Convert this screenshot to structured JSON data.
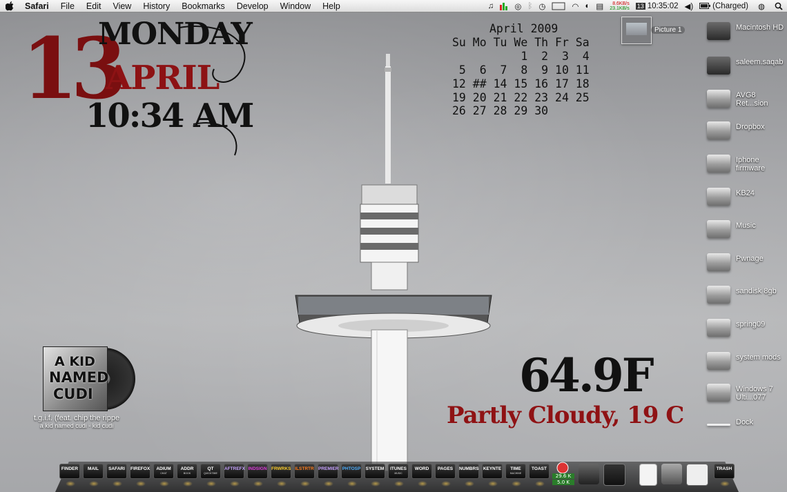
{
  "menubar": {
    "app": "Safari",
    "menus": [
      "File",
      "Edit",
      "View",
      "History",
      "Bookmarks",
      "Develop",
      "Window",
      "Help"
    ],
    "net_up": "8.6KB/s",
    "net_down": "23.1KB/s",
    "date_badge": "13",
    "clock": "10:35:02",
    "battery": "(Charged)"
  },
  "date_widget": {
    "day_number": "13",
    "weekday": "MONDAY",
    "month": "APRIL",
    "time": "10:34 AM"
  },
  "calendar": {
    "header": "April 2009",
    "weekdays": "Su Mo Tu We Th Fr Sa",
    "weeks": [
      "          1  2  3  4",
      " 5  6  7  8  9 10 11",
      "12 ## 14 15 16 17 18",
      "19 20 21 22 23 24 25",
      "26 27 28 29 30"
    ]
  },
  "picture_icon": {
    "label": "Picture 1"
  },
  "desktop_icons": [
    {
      "label": "Macintosh HD",
      "dark": true
    },
    {
      "label": "saleem.saqab",
      "dark": true
    },
    {
      "label": "AVG8 Ret...sion",
      "dark": false
    },
    {
      "label": "Dropbox",
      "dark": false
    },
    {
      "label": "Iphone firmware",
      "dark": false
    },
    {
      "label": "KB24",
      "dark": false
    },
    {
      "label": "Music",
      "dark": false
    },
    {
      "label": "Pwnage",
      "dark": false
    },
    {
      "label": "sandisk 8gb",
      "dark": false
    },
    {
      "label": "spring09",
      "dark": false
    },
    {
      "label": "system mods",
      "dark": false
    },
    {
      "label": "Windows 7 Ulti...077",
      "dark": false
    },
    {
      "label": "Dock",
      "dark": false
    }
  ],
  "now_playing": {
    "cover_line1": "A KID",
    "cover_line2": "NAMED",
    "cover_line3": "CUDI",
    "title": "t.g.i.f. (feat. chip the rippe",
    "artist_album": "a kid named cudi - kid cudi"
  },
  "weather": {
    "temp": "64.9F",
    "condition": "Partly Cloudy, 19 C"
  },
  "dock": {
    "apps": [
      {
        "name": "FINDER",
        "sub": "",
        "color": "#ffffff"
      },
      {
        "name": "MAIL",
        "sub": "",
        "color": "#ffffff"
      },
      {
        "name": "SAFARI",
        "sub": "",
        "color": "#ffffff"
      },
      {
        "name": "FIREFOX",
        "sub": "",
        "color": "#ffffff"
      },
      {
        "name": "ADIUM",
        "sub": "CHAT",
        "color": "#ffffff"
      },
      {
        "name": "ADDR",
        "sub": "BOOK",
        "color": "#ffffff"
      },
      {
        "name": "QT",
        "sub": "QUICKTIME",
        "color": "#ffffff"
      },
      {
        "name": "AFTREFX",
        "sub": "",
        "color": "#c8a4ff"
      },
      {
        "name": "INDSIGN",
        "sub": "",
        "color": "#e040e0"
      },
      {
        "name": "FRWRKS",
        "sub": "",
        "color": "#ffd030"
      },
      {
        "name": "ILSTRTR",
        "sub": "",
        "color": "#ff8020"
      },
      {
        "name": "PREMIER",
        "sub": "",
        "color": "#c8a4ff"
      },
      {
        "name": "PHTOSP",
        "sub": "",
        "color": "#50b0ff"
      },
      {
        "name": "SYSTEM",
        "sub": "",
        "color": "#ffffff"
      },
      {
        "name": "ITUNES",
        "sub": "MUSIC",
        "color": "#ffffff"
      },
      {
        "name": "WORD",
        "sub": "",
        "color": "#ffffff"
      },
      {
        "name": "PAGES",
        "sub": "",
        "color": "#ffffff"
      },
      {
        "name": "NUMBRS",
        "sub": "",
        "color": "#ffffff"
      },
      {
        "name": "KEYNTE",
        "sub": "",
        "color": "#ffffff"
      },
      {
        "name": "TIME",
        "sub": "MACHINE",
        "color": "#ffffff"
      },
      {
        "name": "TOAST",
        "sub": "",
        "color": "#ffffff"
      }
    ],
    "net_meter_up": "29.6 K",
    "net_meter_down": "5.0 K",
    "trash": "TRASH"
  }
}
